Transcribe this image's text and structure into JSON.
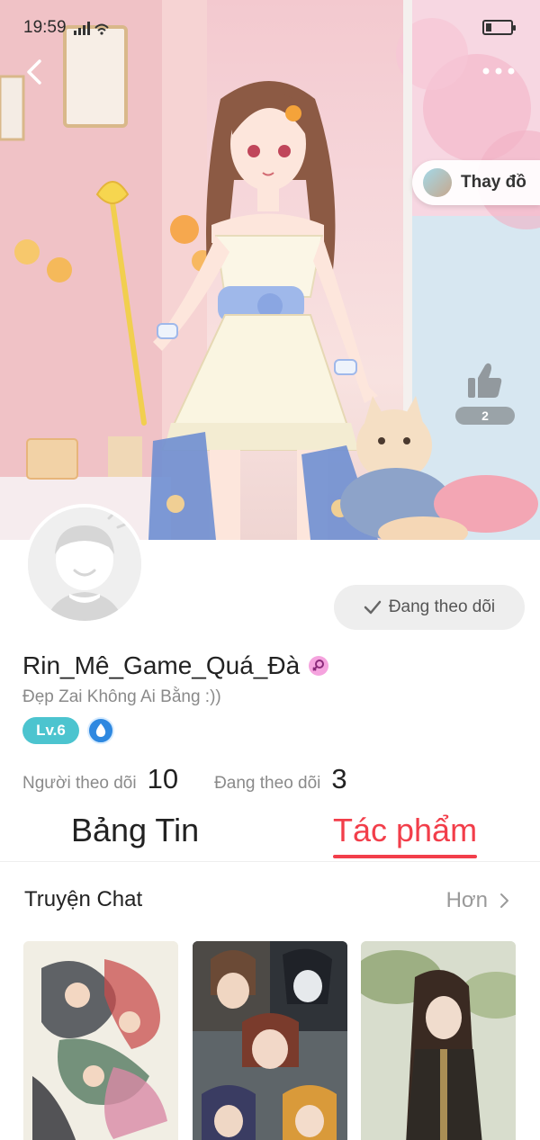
{
  "status_bar": {
    "time": "19:59",
    "network": "4G"
  },
  "hero": {
    "change_button_label": "Thay đồ",
    "like_count": "2"
  },
  "profile": {
    "username": "Rin_Mê_Game_Quá_Đà",
    "bio": "Đẹp Zai Không Ai Bằng :))",
    "level": "Lv.6",
    "follow_button_label": "Đang theo dõi",
    "stats": {
      "followers_label": "Người theo dõi",
      "followers_value": "10",
      "following_label": "Đang theo dõi",
      "following_value": "3"
    }
  },
  "tabs": [
    {
      "label": "Bảng Tin",
      "active": false
    },
    {
      "label": "Tác phẩm",
      "active": true
    }
  ],
  "section": {
    "title": "Truyện Chat",
    "more_label": "Hơn"
  },
  "colors": {
    "accent": "#f23e4a",
    "level_badge": "#4cc4cf",
    "gender_badge": "#f5a3de"
  }
}
